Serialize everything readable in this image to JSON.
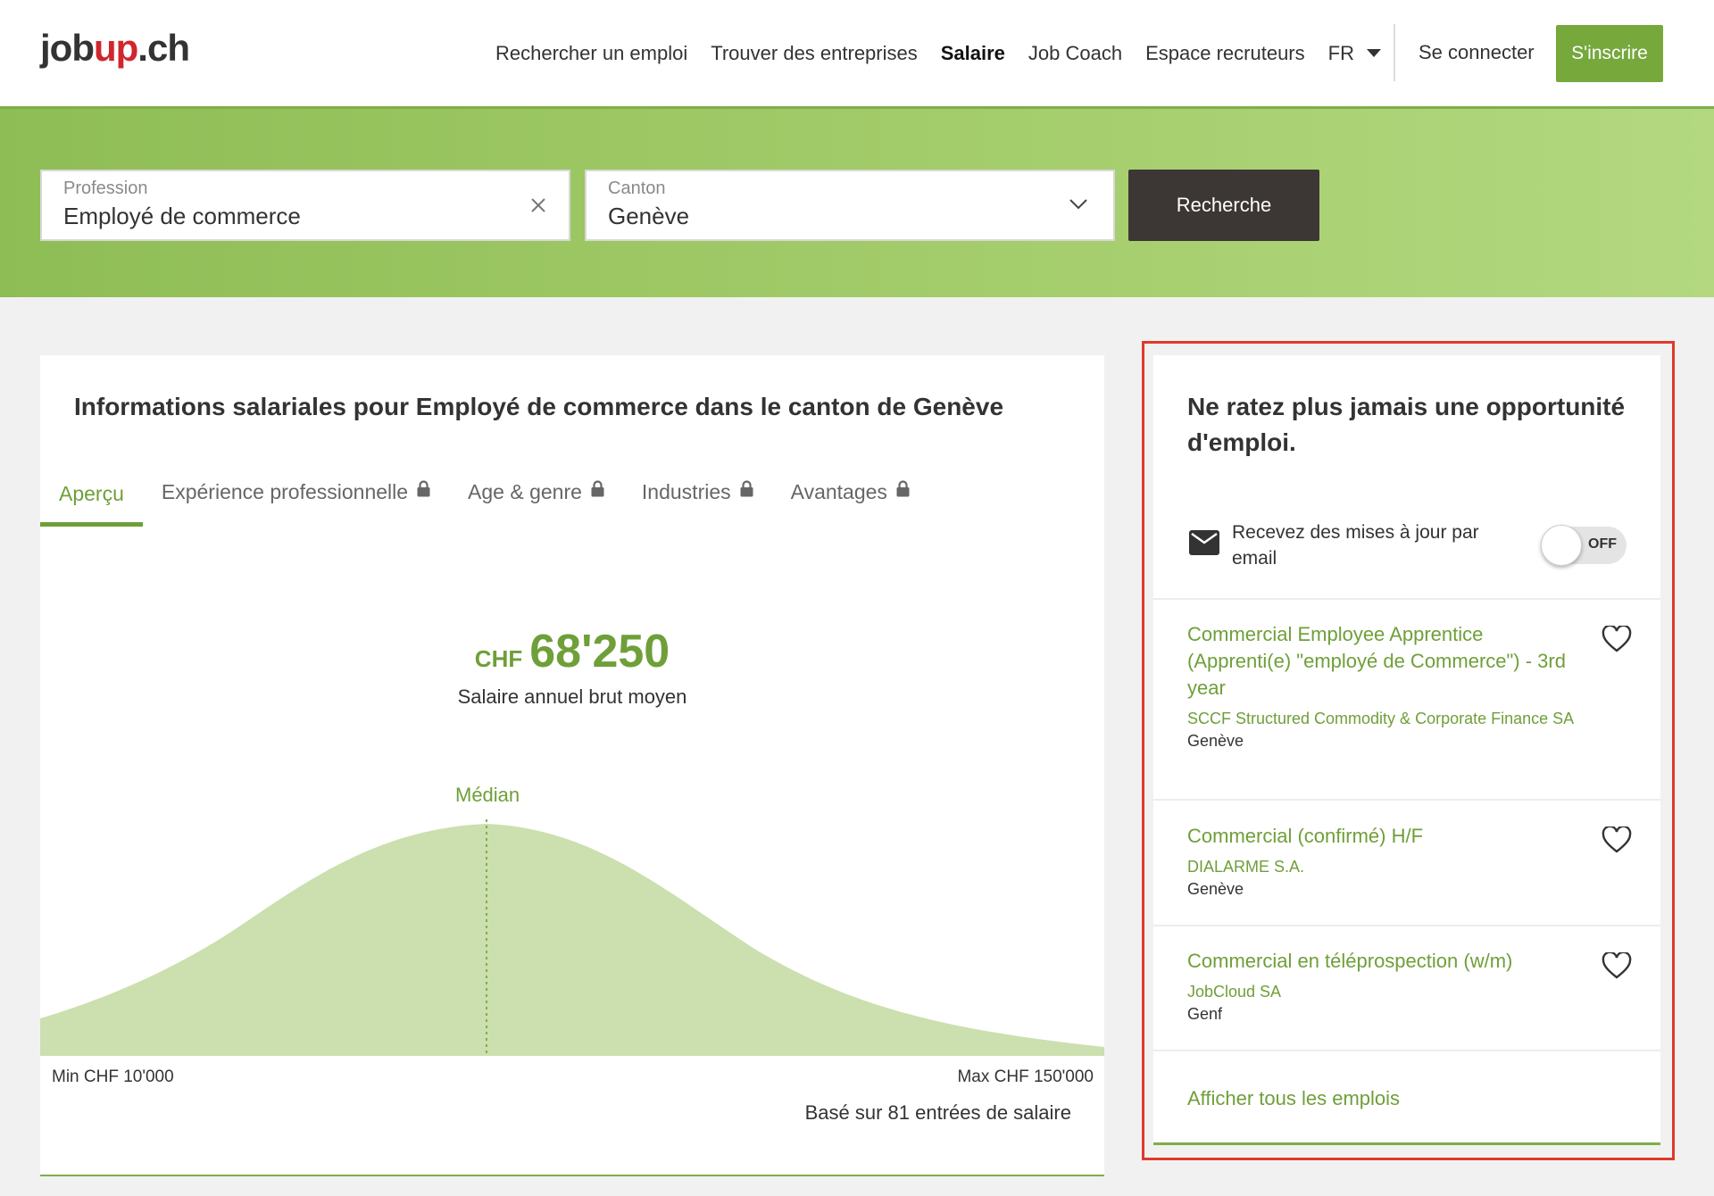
{
  "header": {
    "logo_prefix": "job",
    "logo_accent": "up",
    "logo_suffix": ".ch",
    "nav": [
      "Rechercher un emploi",
      "Trouver des entreprises",
      "Salaire",
      "Job Coach",
      "Espace recruteurs"
    ],
    "language": "FR",
    "login": "Se connecter",
    "signup": "S'inscrire"
  },
  "search": {
    "profession_label": "Profession",
    "profession_value": "Employé de commerce",
    "canton_label": "Canton",
    "canton_value": "Genève",
    "button": "Recherche"
  },
  "salary_card": {
    "title": "Informations salariales pour Employé de commerce dans le canton de Genève",
    "tabs": [
      "Aperçu",
      "Expérience professionnelle",
      "Age & genre",
      "Industries",
      "Avantages"
    ],
    "currency": "CHF",
    "amount": "68'250",
    "amount_label": "Salaire annuel brut moyen",
    "median_label": "Médian",
    "min_label": "Min CHF 10'000",
    "max_label": "Max CHF 150'000",
    "entries": "Basé sur 81 entrées de salaire"
  },
  "side_card": {
    "title": "Ne ratez plus jamais une opportunité d'emploi.",
    "alert_text": "Recevez des mises à jour par email",
    "toggle_state": "OFF",
    "jobs": [
      {
        "title": "Commercial Employee Apprentice (Apprenti(e) \"employé de Commerce\") - 3rd year",
        "company": "SCCF Structured Commodity & Corporate Finance SA",
        "location": "Genève"
      },
      {
        "title": "Commercial (confirmé) H/F",
        "company": "DIALARME S.A.",
        "location": "Genève"
      },
      {
        "title": "Commercial en téléprospection (w/m)",
        "company": "JobCloud SA",
        "location": "Genf"
      }
    ],
    "all_jobs": "Afficher tous les emplois"
  },
  "colors": {
    "brand_green": "#76a83c",
    "logo_red": "#d0262d",
    "highlight_red": "#e0392b",
    "dark_button": "#3c3634",
    "curve_fill": "#cbe0ae"
  }
}
